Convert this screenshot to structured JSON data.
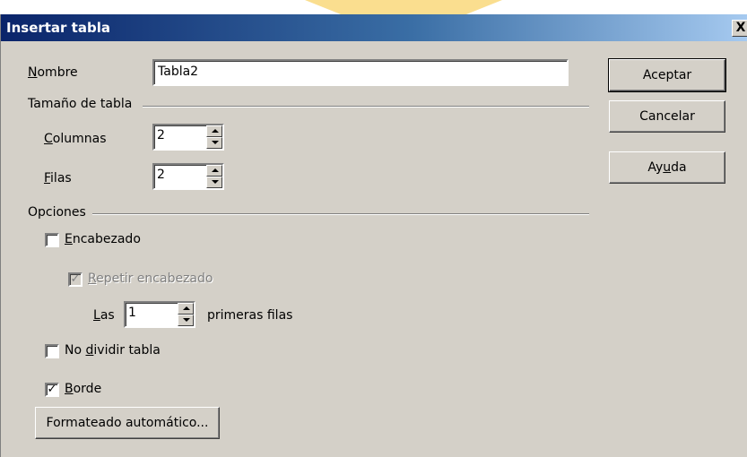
{
  "window": {
    "title": "Insertar tabla",
    "close_glyph": "X"
  },
  "name": {
    "label_u": "N",
    "label_rest": "ombre",
    "value": "Tabla2"
  },
  "size_section": {
    "title": "Tamaño de tabla",
    "columns": {
      "label_u": "C",
      "label_rest": "olumnas",
      "value": "2"
    },
    "rows": {
      "label_u": "F",
      "label_rest": "ilas",
      "value": "2"
    }
  },
  "options_section": {
    "title": "Opciones",
    "header": {
      "label_u": "E",
      "label_rest": "ncabezado",
      "checked": false
    },
    "repeat_header": {
      "label_u": "R",
      "label_rest": "epetir encabezado",
      "checked": true,
      "disabled": true
    },
    "rows_count": {
      "prefix_u": "L",
      "prefix_rest": "as",
      "value": "1",
      "suffix": "primeras filas"
    },
    "no_split": {
      "label_pre": "No ",
      "label_u": "d",
      "label_rest": "ividir tabla",
      "checked": false
    },
    "border": {
      "label_u": "B",
      "label_rest": "orde",
      "checked": true
    },
    "autoformat_button": "Formateado automático..."
  },
  "buttons": {
    "ok": "Aceptar",
    "cancel": "Cancelar",
    "help_pre": "Ay",
    "help_u": "u",
    "help_rest": "da"
  },
  "check_glyph": "✓",
  "colors": {
    "dialog_bg": "#d4d0c8",
    "title_start": "#0a246a",
    "title_end": "#a6caf0",
    "bg_deco": "#f5c230"
  }
}
